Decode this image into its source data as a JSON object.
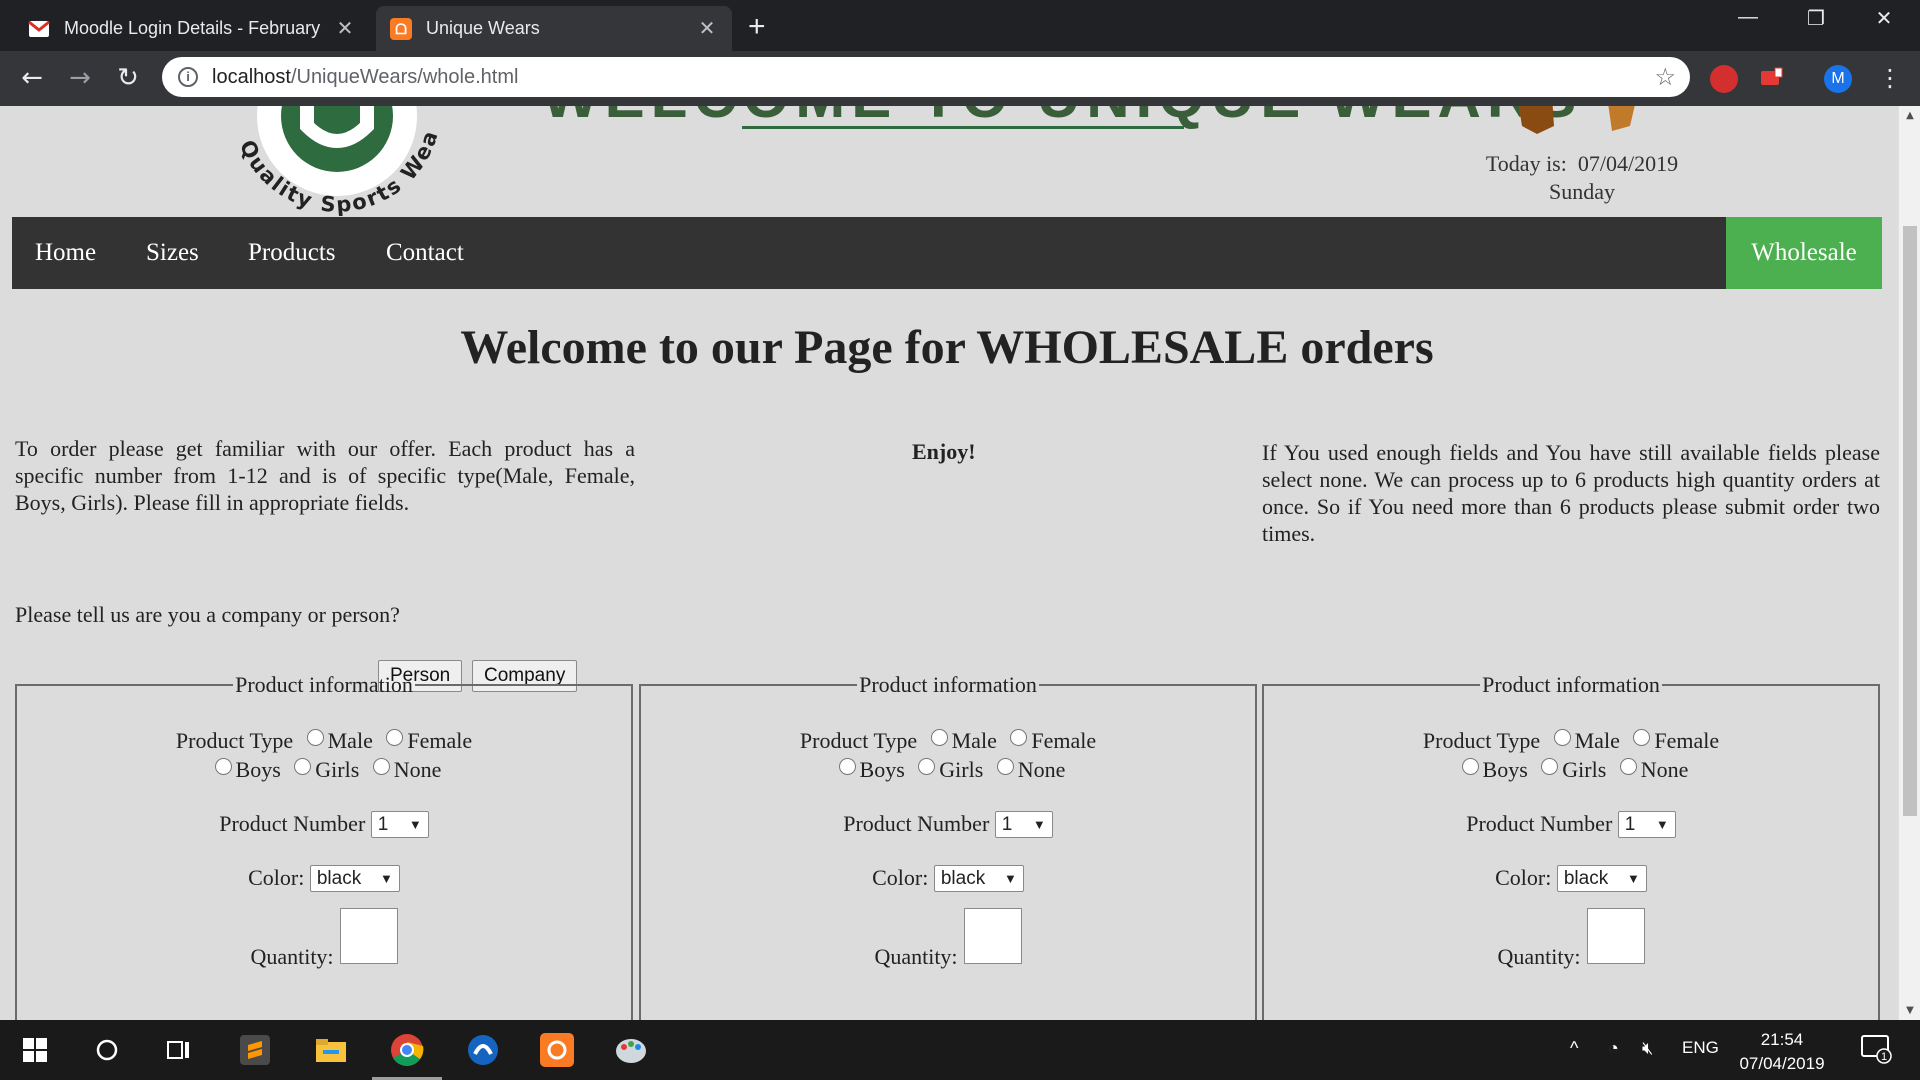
{
  "browser": {
    "tabs": [
      {
        "title": "Moodle Login Details - February",
        "icon": "gmail-icon",
        "active": false
      },
      {
        "title": "Unique Wears",
        "icon": "xampp-icon",
        "active": true
      }
    ],
    "new_tab": "+",
    "url_host": "localhost",
    "url_path": "/UniqueWears/whole.html",
    "profile_initial": "M",
    "window_controls": {
      "minimize": "—",
      "restore": "❐",
      "close": "✕"
    }
  },
  "header": {
    "logo_text": "Quality Sports Wear",
    "banner_title": "WELCOME TO UNIQUE WEARS",
    "date_label": "Today is:",
    "date_value": "07/04/2019",
    "weekday": "Sunday"
  },
  "nav": {
    "items": [
      "Home",
      "Sizes",
      "Products",
      "Contact"
    ],
    "wholesale": "Wholesale"
  },
  "main": {
    "title": "Welcome to our Page for WHOLESALE orders",
    "intro_left": "To order please get familiar with our offer. Each product has a specific number from 1-12 and is of specific type(Male, Female, Boys, Girls). Please fill in appropriate fields.",
    "intro_mid": "Enjoy!",
    "intro_right": "If You used enough fields and You have still available fields please select none. We can process up to 6 products high quantity orders at once. So if You need more than 6 products please submit order two times.",
    "ask": "Please tell us are you a company or person?",
    "person_button": "Person",
    "company_button": "Company"
  },
  "product_form": {
    "legend": "Product information",
    "type_label": "Product Type",
    "types_row1": [
      "Male",
      "Female"
    ],
    "types_row2": [
      "Boys",
      "Girls",
      "None"
    ],
    "number_label": "Product Number",
    "number_value": "1",
    "color_label": "Color:",
    "color_value": "black",
    "quantity_label": "Quantity:"
  },
  "taskbar": {
    "time": "21:54",
    "date": "07/04/2019",
    "language": "ENG",
    "notifications": "1"
  },
  "colors": {
    "nav_bg": "#333333",
    "wholesale_bg": "#4caf50",
    "page_bg": "#dcdcdc",
    "logo_green": "#2e6b3e"
  }
}
